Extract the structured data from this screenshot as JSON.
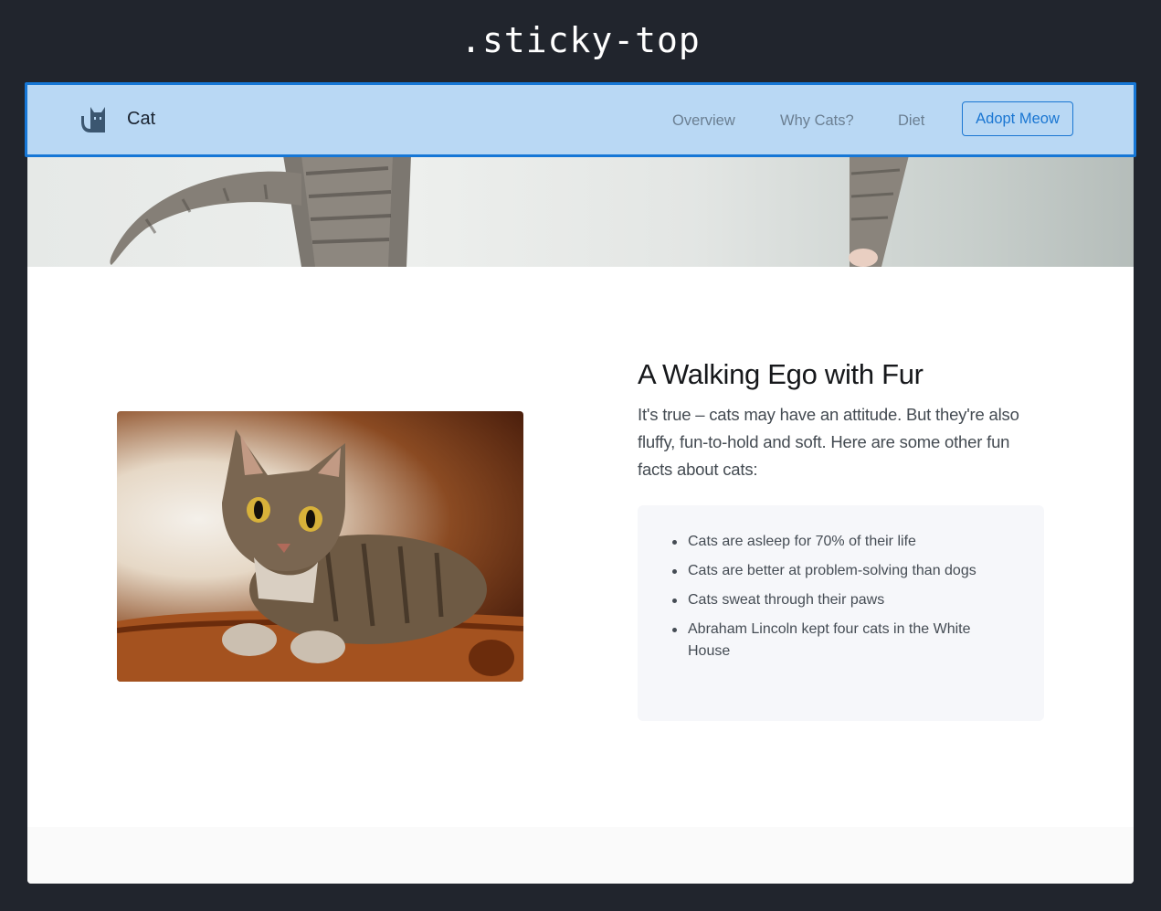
{
  "caption": ".sticky-top",
  "navbar": {
    "brand_name": "Cat",
    "brand_icon": "cat-logo-icon",
    "links": [
      "Overview",
      "Why Cats?",
      "Diet"
    ],
    "cta_label": "Adopt Meow",
    "background_color": "#b9d8f4",
    "highlight_border_color": "#1677d6",
    "accent_color": "#1a76d2"
  },
  "main": {
    "heading": "A Walking Ego with Fur",
    "intro": "It's true – cats may have an attitude. But they're also fluffy, fun-to-hold and soft. Here are some other fun facts about cats:",
    "facts": [
      "Cats are asleep for 70% of their life",
      "Cats are better at problem-solving than dogs",
      "Cats sweat through their paws",
      "Abraham Lincoln kept four cats in the White House"
    ]
  },
  "colors": {
    "page_background": "#21252d",
    "content_background": "#ffffff",
    "facts_background": "#f6f7fa"
  }
}
